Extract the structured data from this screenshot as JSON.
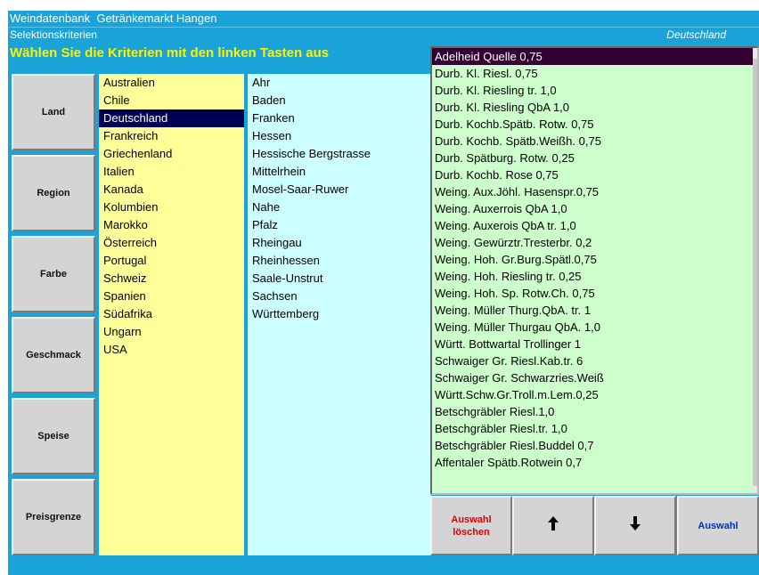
{
  "window": {
    "title": "Weindatenbank  Getränkemarkt Hangen"
  },
  "subheader": {
    "label": "Selektionskriterien",
    "current_selection": "Deutschland"
  },
  "instruction": "Wählen Sie die Kriterien mit den linken Tasten aus",
  "side_buttons": [
    {
      "label": "Land"
    },
    {
      "label": "Region"
    },
    {
      "label": "Farbe"
    },
    {
      "label": "Geschmack"
    },
    {
      "label": "Speise"
    },
    {
      "label": "Preisgrenze"
    }
  ],
  "countries": {
    "selected": "Deutschland",
    "items": [
      "Australien",
      "Chile",
      "Deutschland",
      "Frankreich",
      "Griechenland",
      "Italien",
      "Kanada",
      "Kolumbien",
      "Marokko",
      "Österreich",
      "Portugal",
      "Schweiz",
      "Spanien",
      "Südafrika",
      "Ungarn",
      "USA"
    ]
  },
  "regions": {
    "items": [
      "Ahr",
      "Baden",
      "Franken",
      "Hessen",
      "Hessische Bergstrasse",
      "Mittelrhein",
      "Mosel-Saar-Ruwer",
      "Nahe",
      "Pfalz",
      "Rheingau",
      "Rheinhessen",
      "Saale-Unstrut",
      "Sachsen",
      "Württemberg"
    ]
  },
  "wines": {
    "selected": "Adelheid Quelle  0,75",
    "items": [
      "Adelheid Quelle  0,75",
      "Durb. Kl. Riesl. 0,75",
      "Durb. Kl. Riesling tr. 1,0",
      "Durb. Kl. Riesling QbA 1,0",
      "Durb. Kochb.Spätb. Rotw. 0,75",
      "Durb. Kochb. Spätb.Weißh. 0,75",
      "Durb. Spätburg. Rotw.  0,25",
      "Durb. Kochb. Rose 0,75",
      "Weing. Aux.Jöhl. Hasenspr.0,75",
      "Weing. Auxerrois QbA 1,0",
      "Weing. Auxerois QbA tr. 1,0",
      "Weing. Gewürztr.Tresterbr. 0,2",
      "Weing. Hoh. Gr.Burg.Spätl.0,75",
      "Weing. Hoh. Riesling tr. 0,25",
      "Weing. Hoh. Sp. Rotw.Ch. 0,75",
      "Weing. Müller Thurg.QbA. tr. 1",
      "Weing. Müller Thurgau QbA. 1,0",
      "Württ. Bottwartal Trollinger 1",
      "Schwaiger Gr. Riesl.Kab.tr. 6",
      "Schwaiger Gr. Schwarzries.Weiß",
      "Württ.Schw.Gr.Troll.m.Lem.0,25",
      "Betschgräbler Riesl.1,0",
      "Betschgräbler Riesl.tr. 1,0",
      "Betschgräbler Riesl.Buddel 0,7",
      "Affentaler Spätb.Rotwein 0,7"
    ]
  },
  "actions": {
    "clear_line1": "Auswahl",
    "clear_line2": "löschen",
    "up_icon": "arrow-up-icon",
    "down_icon": "arrow-down-icon",
    "select_label": "Auswahl"
  },
  "colors": {
    "background": "#1aa3d9",
    "instruction": "#fff200",
    "countries_bg": "#ffff99",
    "regions_bg": "#ccffff",
    "wines_bg": "#ccffcc",
    "selection": "#000055",
    "clear_text": "#e00000",
    "select_text": "#0030c0"
  }
}
